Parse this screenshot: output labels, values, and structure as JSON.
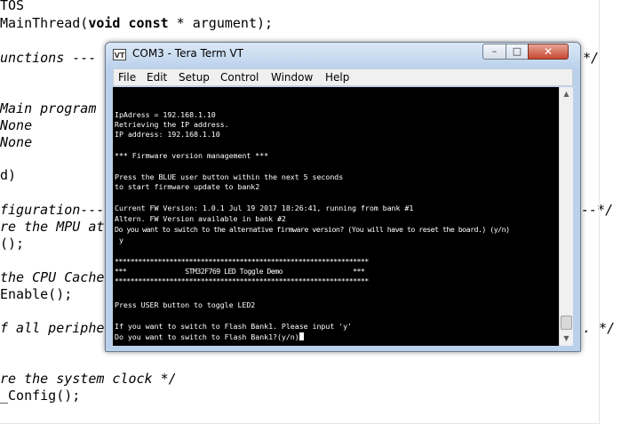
{
  "editor": {
    "lines": [
      {
        "t": "TOS",
        "c": ""
      },
      {
        "t": "MainThread(void const * argument);",
        "c": "code"
      },
      {
        "t": "unctions ---",
        "c": "cm",
        "tail": "*/"
      },
      {
        "t": "Main program",
        "c": "cm"
      },
      {
        "t": "None",
        "c": "cm"
      },
      {
        "t": "None",
        "c": "cm"
      },
      {
        "t": "d)",
        "c": ""
      },
      {
        "t": "figuration---",
        "c": "cm",
        "tail": "--*/"
      },
      {
        "t": "re the MPU at",
        "c": "cm"
      },
      {
        "t": "();",
        "c": ""
      },
      {
        "t": "the CPU Cache",
        "c": "cm"
      },
      {
        "t": "Enable();",
        "c": ""
      },
      {
        "t": "f all periphe",
        "c": "cm",
        "tail": ". */"
      },
      {
        "t": "re the system clock */",
        "c": "cm"
      },
      {
        "t": "_Config();",
        "c": ""
      }
    ]
  },
  "window": {
    "title": "COM3 - Tera Term VT",
    "icon_label": "VT",
    "buttons": {
      "minimize": "–",
      "maximize": "□",
      "close": "✕"
    }
  },
  "menu": [
    "File",
    "Edit",
    "Setup",
    "Control",
    "Window",
    "Help"
  ],
  "terminal": {
    "lines": [
      "IpAdress = 192.168.1.10",
      "Retrieving the IP address.",
      "IP address: 192.168.1.10",
      "",
      "*** Firmware version management ***",
      "",
      "Press the BLUE user button within the next 5 seconds",
      "to start firmware update to bank2",
      "",
      "Current FW Version: 1.0.1 Jul 19 2017 18:26:41, running from bank #1",
      "Altern. FW Version available in bank #2",
      "Do you want to switch to the alternative firmware version? (You will have to reset the board.) (y/n)",
      " y",
      "",
      "*****************************************************************",
      "***               STM32F769 LED Toggle Demo                  ***",
      "*****************************************************************",
      "",
      "Press USER button to toggle LED2",
      "",
      "If you want to switch to Flash Bank1. Please input 'y'",
      "Do you want to switch to Flash Bank1?(y/n)"
    ]
  },
  "scrollbar": {
    "up": "▲",
    "down": "▼"
  }
}
